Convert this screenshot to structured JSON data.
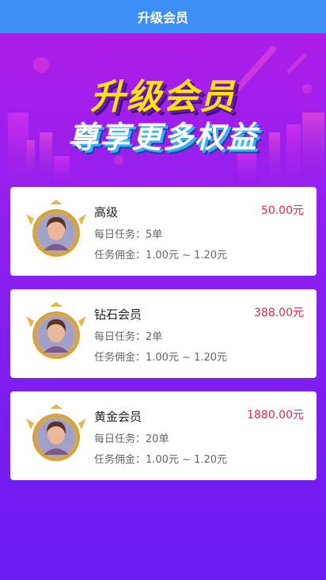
{
  "header": {
    "title": "升级会员"
  },
  "banner": {
    "line1": "升级会员",
    "line2": "尊享更多权益"
  },
  "levels": [
    {
      "name": "高级",
      "price": "50.00元",
      "daily_task": "每日任务：5单",
      "commission": "任务佣金：1.00元 ~ 1.20元"
    },
    {
      "name": "钻石会员",
      "price": "388.00元",
      "daily_task": "每日任务：2单",
      "commission": "任务佣金：1.00元 ~ 1.20元"
    },
    {
      "name": "黄金会员",
      "price": "1880.00元",
      "daily_task": "每日任务：20单",
      "commission": "任务佣金：1.00元 ~ 1.20元"
    }
  ],
  "colors": {
    "header_bg": "#3d8ef7",
    "price": "#e8264a",
    "accent_gold": "#d8a43a"
  },
  "icons": {
    "avatar": "member-avatar-gold-frame-icon"
  }
}
